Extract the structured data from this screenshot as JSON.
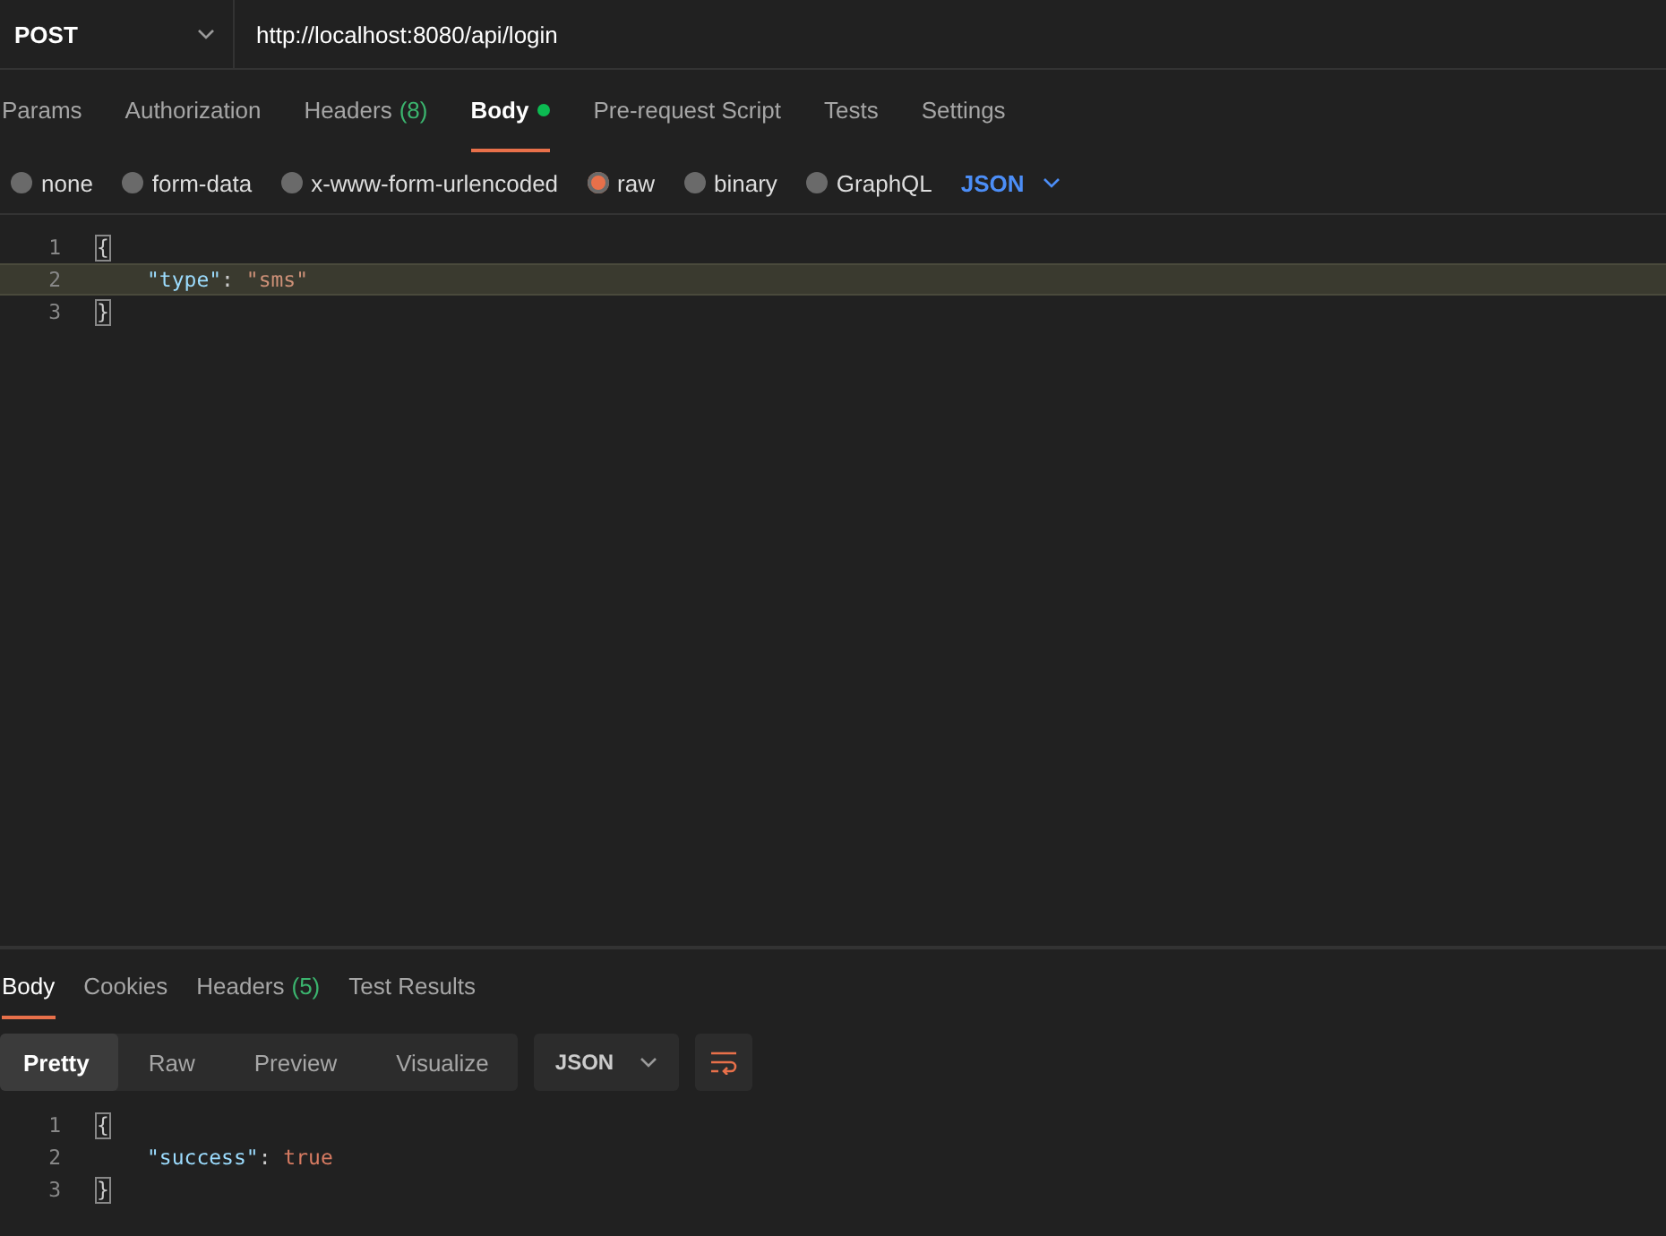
{
  "request": {
    "method": "POST",
    "url": "http://localhost:8080/api/login"
  },
  "request_tabs": [
    {
      "label": "Params",
      "selected": false
    },
    {
      "label": "Authorization",
      "selected": false
    },
    {
      "label": "Headers",
      "count": "(8)",
      "selected": false
    },
    {
      "label": "Body",
      "dot": true,
      "selected": true
    },
    {
      "label": "Pre-request Script",
      "selected": false
    },
    {
      "label": "Tests",
      "selected": false
    },
    {
      "label": "Settings",
      "selected": false
    }
  ],
  "body_types": [
    {
      "label": "none",
      "selected": false
    },
    {
      "label": "form-data",
      "selected": false
    },
    {
      "label": "x-www-form-urlencoded",
      "selected": false
    },
    {
      "label": "raw",
      "selected": true
    },
    {
      "label": "binary",
      "selected": false
    },
    {
      "label": "GraphQL",
      "selected": false
    }
  ],
  "body_format": "JSON",
  "request_body": [
    {
      "number": "1",
      "highlighted": false,
      "tokens": [
        {
          "kind": "brace",
          "text": "{"
        }
      ]
    },
    {
      "number": "2",
      "highlighted": true,
      "tokens": [
        {
          "kind": "key",
          "text": "\"type\""
        },
        {
          "kind": "punct",
          "text": ": "
        },
        {
          "kind": "string",
          "text": "\"sms\""
        }
      ]
    },
    {
      "number": "3",
      "highlighted": false,
      "tokens": [
        {
          "kind": "brace",
          "text": "}"
        }
      ]
    }
  ],
  "response_tabs": [
    {
      "label": "Body",
      "selected": true
    },
    {
      "label": "Cookies",
      "selected": false
    },
    {
      "label": "Headers",
      "count": "(5)",
      "selected": false
    },
    {
      "label": "Test Results",
      "selected": false
    }
  ],
  "view_modes": [
    {
      "label": "Pretty",
      "selected": true
    },
    {
      "label": "Raw",
      "selected": false
    },
    {
      "label": "Preview",
      "selected": false
    },
    {
      "label": "Visualize",
      "selected": false
    }
  ],
  "response_format": "JSON",
  "response_body": [
    {
      "number": "1",
      "highlighted": false,
      "tokens": [
        {
          "kind": "brace",
          "text": "{"
        }
      ]
    },
    {
      "number": "2",
      "highlighted": false,
      "tokens": [
        {
          "kind": "key",
          "text": "\"success\""
        },
        {
          "kind": "punct",
          "text": ": "
        },
        {
          "kind": "literal",
          "text": "true"
        }
      ]
    },
    {
      "number": "3",
      "highlighted": false,
      "tokens": [
        {
          "kind": "brace",
          "text": "}"
        }
      ]
    }
  ]
}
